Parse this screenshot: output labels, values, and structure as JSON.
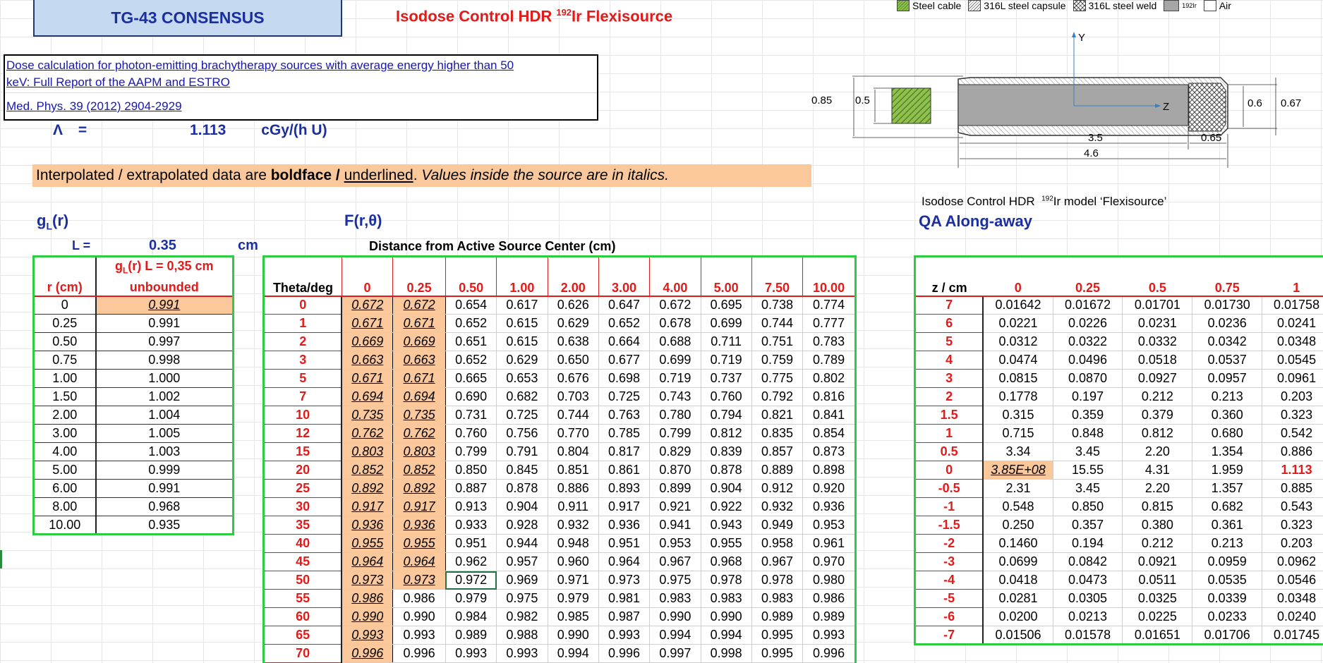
{
  "header": {
    "title": "TG-43 CONSENSUS",
    "source_pre": "Isodose Control HDR ",
    "source_sup": "192",
    "source_post": "Ir Flexisource"
  },
  "reference": {
    "line1": "Dose calculation for photon-emitting brachytherapy sources with average energy higher than 50",
    "line2": "keV: Full Report of the AAPM and ESTRO",
    "journal": "Med. Phys. 39 (2012) 2904-2929"
  },
  "lambda": {
    "symbol": "Λ",
    "eq": "=",
    "value": "1.113",
    "unit": "cGy/(h U)"
  },
  "note": {
    "p1": "Interpolated / extrapolated data are ",
    "bold": "boldface",
    "sep": " / ",
    "underline": "underlined",
    "p2": ". ",
    "italic": "Values inside the source are in italics."
  },
  "legend": {
    "items": [
      "Steel cable",
      "316L steel capsule",
      "316L steel weld",
      "192Ir",
      "Air"
    ],
    "colors": [
      "#8fc04d",
      "#d9d9d9",
      "#ffffff",
      "#a6a6a6",
      "#ffffff"
    ]
  },
  "diagram": {
    "dim_085": "0.85",
    "dim_05": "0.5",
    "dim_06": "0.6",
    "dim_067": "0.67",
    "dim_35": "3.5",
    "dim_065": "0.65",
    "dim_46": "4.6",
    "axis_y": "Y",
    "axis_z": "Z",
    "caption_pre": "Isodose Control HDR  ",
    "caption_sup": "192",
    "caption_post": "Ir model ‘Flexisource’"
  },
  "gl": {
    "title_g": "g",
    "title_sub": "L",
    "title_post": "(r)",
    "L_label": "L =",
    "L_value": "0.35",
    "L_unit": "cm",
    "col0": "r (cm)",
    "col1_a": "g",
    "col1_sub": "L",
    "col1_b": "(r) L = 0,35 cm",
    "col1_c": "unbounded",
    "rows": [
      [
        "0",
        "0.991"
      ],
      [
        "0.25",
        "0.991"
      ],
      [
        "0.50",
        "0.997"
      ],
      [
        "0.75",
        "0.998"
      ],
      [
        "1.00",
        "1.000"
      ],
      [
        "1.50",
        "1.002"
      ],
      [
        "2.00",
        "1.004"
      ],
      [
        "3.00",
        "1.005"
      ],
      [
        "4.00",
        "1.003"
      ],
      [
        "5.00",
        "0.999"
      ],
      [
        "6.00",
        "0.991"
      ],
      [
        "8.00",
        "0.968"
      ],
      [
        "10.00",
        "0.935"
      ]
    ]
  },
  "F": {
    "title": "F(r,θ)",
    "subtitle": "Distance from Active Source Center (cm)",
    "headers": [
      "Theta/deg",
      "0",
      "0.25",
      "0.50",
      "1.00",
      "2.00",
      "3.00",
      "4.00",
      "5.00",
      "7.50",
      "10.00"
    ],
    "rows": [
      [
        "0",
        "0.672",
        "0.672",
        "0.654",
        "0.617",
        "0.626",
        "0.647",
        "0.672",
        "0.695",
        "0.738",
        "0.774"
      ],
      [
        "1",
        "0.671",
        "0.671",
        "0.652",
        "0.615",
        "0.629",
        "0.652",
        "0.678",
        "0.699",
        "0.744",
        "0.777"
      ],
      [
        "2",
        "0.669",
        "0.669",
        "0.651",
        "0.615",
        "0.638",
        "0.664",
        "0.688",
        "0.711",
        "0.751",
        "0.783"
      ],
      [
        "3",
        "0.663",
        "0.663",
        "0.652",
        "0.629",
        "0.650",
        "0.677",
        "0.699",
        "0.719",
        "0.759",
        "0.789"
      ],
      [
        "5",
        "0.671",
        "0.671",
        "0.665",
        "0.653",
        "0.676",
        "0.698",
        "0.719",
        "0.737",
        "0.775",
        "0.802"
      ],
      [
        "7",
        "0.694",
        "0.694",
        "0.690",
        "0.682",
        "0.703",
        "0.725",
        "0.743",
        "0.760",
        "0.792",
        "0.816"
      ],
      [
        "10",
        "0.735",
        "0.735",
        "0.731",
        "0.725",
        "0.744",
        "0.763",
        "0.780",
        "0.794",
        "0.821",
        "0.841"
      ],
      [
        "12",
        "0.762",
        "0.762",
        "0.760",
        "0.756",
        "0.770",
        "0.785",
        "0.799",
        "0.812",
        "0.835",
        "0.854"
      ],
      [
        "15",
        "0.803",
        "0.803",
        "0.799",
        "0.791",
        "0.804",
        "0.817",
        "0.829",
        "0.839",
        "0.857",
        "0.873"
      ],
      [
        "20",
        "0.852",
        "0.852",
        "0.850",
        "0.845",
        "0.851",
        "0.861",
        "0.870",
        "0.878",
        "0.889",
        "0.898"
      ],
      [
        "25",
        "0.892",
        "0.892",
        "0.887",
        "0.878",
        "0.886",
        "0.893",
        "0.899",
        "0.904",
        "0.912",
        "0.920"
      ],
      [
        "30",
        "0.917",
        "0.917",
        "0.913",
        "0.904",
        "0.911",
        "0.917",
        "0.921",
        "0.922",
        "0.932",
        "0.936"
      ],
      [
        "35",
        "0.936",
        "0.936",
        "0.933",
        "0.928",
        "0.932",
        "0.936",
        "0.941",
        "0.943",
        "0.949",
        "0.953"
      ],
      [
        "40",
        "0.955",
        "0.955",
        "0.951",
        "0.944",
        "0.948",
        "0.951",
        "0.953",
        "0.955",
        "0.958",
        "0.961"
      ],
      [
        "45",
        "0.964",
        "0.964",
        "0.962",
        "0.957",
        "0.960",
        "0.964",
        "0.967",
        "0.968",
        "0.967",
        "0.970"
      ],
      [
        "50",
        "0.973",
        "0.973",
        "0.972",
        "0.969",
        "0.971",
        "0.973",
        "0.975",
        "0.978",
        "0.978",
        "0.980"
      ],
      [
        "55",
        "0.986",
        "0.986",
        "0.979",
        "0.975",
        "0.979",
        "0.981",
        "0.983",
        "0.983",
        "0.983",
        "0.986"
      ],
      [
        "60",
        "0.990",
        "0.990",
        "0.984",
        "0.982",
        "0.985",
        "0.987",
        "0.990",
        "0.990",
        "0.989",
        "0.989"
      ],
      [
        "65",
        "0.993",
        "0.993",
        "0.989",
        "0.988",
        "0.990",
        "0.993",
        "0.994",
        "0.994",
        "0.995",
        "0.993"
      ],
      [
        "70",
        "0.996",
        "0.996",
        "0.993",
        "0.993",
        "0.994",
        "0.996",
        "0.997",
        "0.998",
        "0.995",
        "0.996"
      ]
    ]
  },
  "QA": {
    "title": "QA Along-away",
    "headers": [
      "z / cm",
      "0",
      "0.25",
      "0.5",
      "0.75",
      "1"
    ],
    "rows": [
      [
        "7",
        "0.01642",
        "0.01672",
        "0.01701",
        "0.01730",
        "0.01758"
      ],
      [
        "6",
        "0.0221",
        "0.0226",
        "0.0231",
        "0.0236",
        "0.0241"
      ],
      [
        "5",
        "0.0312",
        "0.0322",
        "0.0332",
        "0.0342",
        "0.0348"
      ],
      [
        "4",
        "0.0474",
        "0.0496",
        "0.0518",
        "0.0537",
        "0.0545"
      ],
      [
        "3",
        "0.0815",
        "0.0870",
        "0.0927",
        "0.0957",
        "0.0961"
      ],
      [
        "2",
        "0.1778",
        "0.197",
        "0.212",
        "0.213",
        "0.203"
      ],
      [
        "1.5",
        "0.315",
        "0.359",
        "0.379",
        "0.360",
        "0.323"
      ],
      [
        "1",
        "0.715",
        "0.848",
        "0.812",
        "0.680",
        "0.542"
      ],
      [
        "0.5",
        "3.34",
        "3.45",
        "2.20",
        "1.354",
        "0.886"
      ],
      [
        "0",
        "3.85E+08",
        "15.55",
        "4.31",
        "1.959",
        "1.113"
      ],
      [
        "-0.5",
        "2.31",
        "3.45",
        "2.20",
        "1.357",
        "0.885"
      ],
      [
        "-1",
        "0.548",
        "0.850",
        "0.815",
        "0.682",
        "0.543"
      ],
      [
        "-1.5",
        "0.250",
        "0.357",
        "0.380",
        "0.361",
        "0.323"
      ],
      [
        "-2",
        "0.1460",
        "0.194",
        "0.212",
        "0.213",
        "0.203"
      ],
      [
        "-3",
        "0.0699",
        "0.0842",
        "0.0921",
        "0.0959",
        "0.0962"
      ],
      [
        "-4",
        "0.0418",
        "0.0473",
        "0.0511",
        "0.0535",
        "0.0546"
      ],
      [
        "-5",
        "0.0281",
        "0.0305",
        "0.0325",
        "0.0339",
        "0.0348"
      ],
      [
        "-6",
        "0.0200",
        "0.0213",
        "0.0225",
        "0.0233",
        "0.0240"
      ],
      [
        "-7",
        "0.01506",
        "0.01578",
        "0.01651",
        "0.01706",
        "0.01745"
      ]
    ]
  }
}
